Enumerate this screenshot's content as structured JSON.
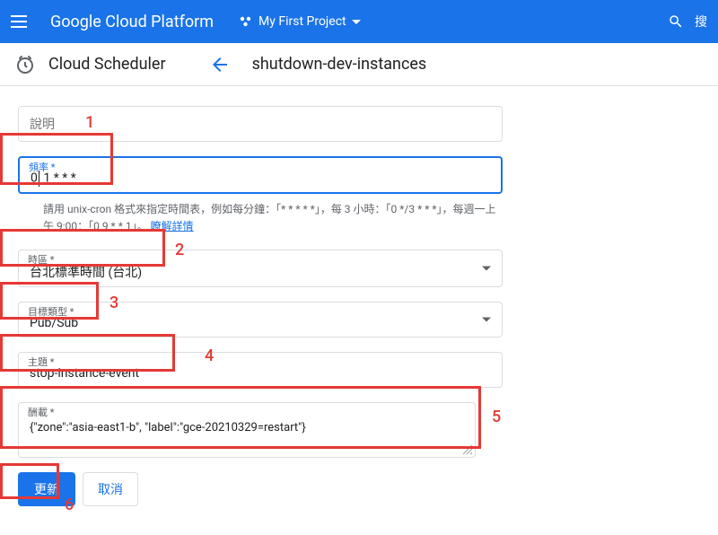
{
  "header": {
    "platform_title": "Google Cloud Platform",
    "project_name": "My First Project",
    "search_label": "搜"
  },
  "subheader": {
    "product_title": "Cloud Scheduler",
    "job_name": "shutdown-dev-instances"
  },
  "form": {
    "description": {
      "placeholder": "說明"
    },
    "frequency": {
      "label": "頻率 *",
      "value_before_cursor": "0",
      "value_after_cursor": " 1 * * *",
      "help_text_pre": "請用 unix-cron 格式來指定時間表，例如每分鐘：「* * * * *」，每 3 小時：「0 */3 * * *」，每週一上午 9:00：「0 9 * * 1」。",
      "help_link": "瞭解詳情"
    },
    "timezone": {
      "label": "時區 *",
      "value": "台北標準時間 (台北)"
    },
    "target_type": {
      "label": "目標類型 *",
      "value": "Pub/Sub"
    },
    "topic": {
      "label": "主題 *",
      "value": "stop-instance-event"
    },
    "payload": {
      "label": "酬載 *",
      "value": "{\"zone\":\"asia-east1-b\", \"label\":\"gce-20210329=restart\"}"
    }
  },
  "buttons": {
    "update": "更新",
    "cancel": "取消"
  },
  "annotations": {
    "n1": "1",
    "n2": "2",
    "n3": "3",
    "n4": "4",
    "n5": "5",
    "n6": "6"
  }
}
